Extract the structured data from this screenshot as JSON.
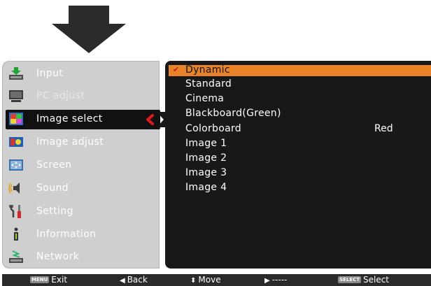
{
  "left_menu": {
    "items": [
      {
        "label": "Input",
        "icon": "input-icon",
        "state": "normal"
      },
      {
        "label": "PC adjust",
        "icon": "pc-adjust-icon",
        "state": "disabled"
      },
      {
        "label": "Image select",
        "icon": "image-select-icon",
        "state": "selected"
      },
      {
        "label": "Image adjust",
        "icon": "image-adjust-icon",
        "state": "normal"
      },
      {
        "label": "Screen",
        "icon": "screen-icon",
        "state": "normal"
      },
      {
        "label": "Sound",
        "icon": "sound-icon",
        "state": "normal"
      },
      {
        "label": "Setting",
        "icon": "setting-icon",
        "state": "normal"
      },
      {
        "label": "Information",
        "icon": "information-icon",
        "state": "normal"
      },
      {
        "label": "Network",
        "icon": "network-icon",
        "state": "normal"
      }
    ]
  },
  "submenu": {
    "items": [
      {
        "label": "Dynamic",
        "selected": true,
        "checked": true
      },
      {
        "label": "Standard"
      },
      {
        "label": "Cinema"
      },
      {
        "label": "Blackboard(Green)"
      },
      {
        "label": "Colorboard",
        "value": "Red"
      },
      {
        "label": "Image 1"
      },
      {
        "label": "Image 2"
      },
      {
        "label": "Image 3"
      },
      {
        "label": "Image 4"
      }
    ]
  },
  "status_bar": {
    "menu_badge": "MENU",
    "exit_label": "Exit",
    "back_label": "Back",
    "move_label": "Move",
    "next_label": "-----",
    "select_badge": "SELECT",
    "select_label": "Select"
  },
  "colors": {
    "highlight": "#e8832a",
    "selected_bg": "#111111",
    "panel_gray": "#cfcfcf",
    "chevron_red": "#e01b1b"
  }
}
